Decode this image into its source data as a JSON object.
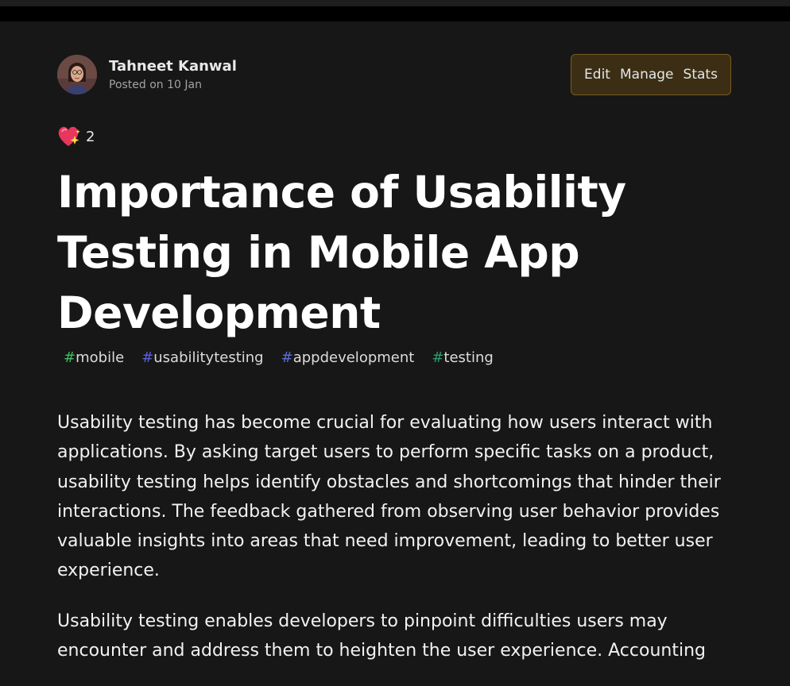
{
  "author": {
    "name": "Tahneet Kanwal",
    "posted": "Posted on 10 Jan"
  },
  "actions": {
    "edit": "Edit",
    "manage": "Manage",
    "stats": "Stats"
  },
  "reactions": {
    "count": "2",
    "icon": "sparkling-heart-icon"
  },
  "article": {
    "title": "Importance of Usability Testing in Mobile App Development",
    "tags": [
      {
        "hash": "#",
        "name": "mobile",
        "color": "#3fbf5f"
      },
      {
        "hash": "#",
        "name": "usabilitytesting",
        "color": "#5b5fe0"
      },
      {
        "hash": "#",
        "name": "appdevelopment",
        "color": "#5b6fd8"
      },
      {
        "hash": "#",
        "name": "testing",
        "color": "#2e9a6c"
      }
    ],
    "paragraphs": [
      "Usability testing has become crucial for evaluating how users interact with applications. By asking target users to perform specific tasks on a product, usability testing helps identify obstacles and shortcomings that hinder their interactions. The feedback gathered from observing user behavior provides valuable insights into areas that need improvement, leading to better user experience.",
      "Usability testing enables developers to pinpoint difficulties users may encounter and address them to heighten the user experience. Accounting"
    ]
  },
  "colors": {
    "background": "#171717",
    "action_bg": "#3b2e14",
    "action_border": "#7a5c1f"
  }
}
